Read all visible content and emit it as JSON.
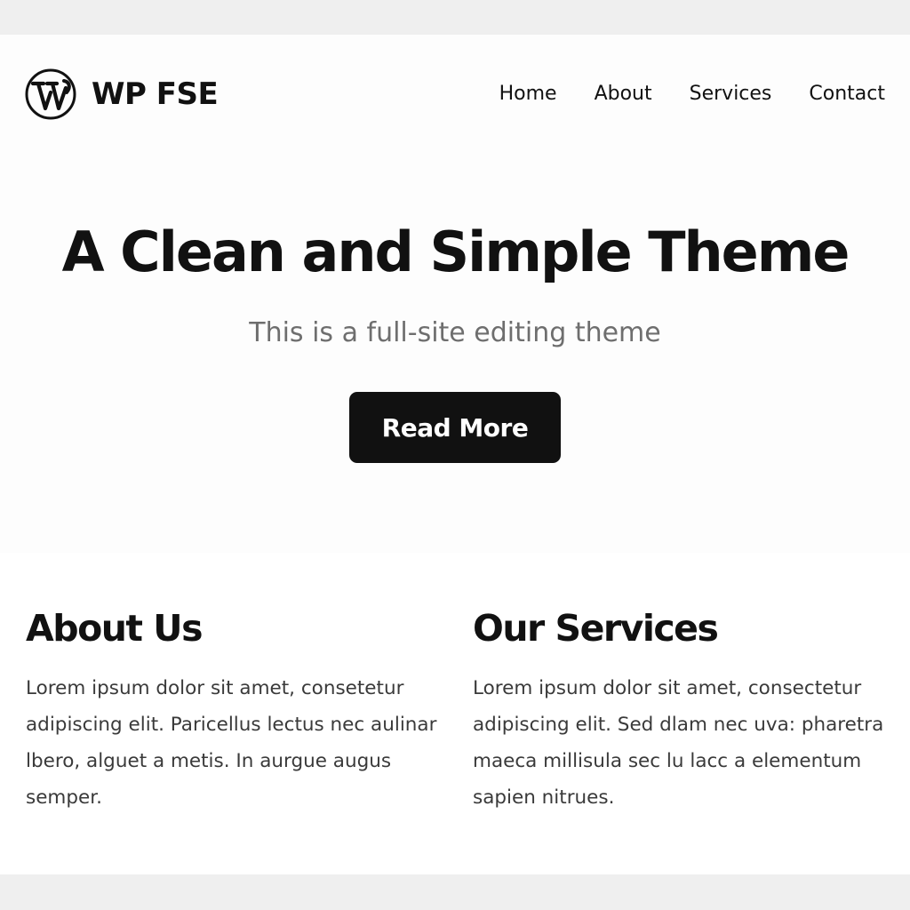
{
  "header": {
    "site_title": "WP FSE",
    "logo_icon": "wordpress-logo-icon",
    "nav": [
      "Home",
      "About",
      "Services",
      "Contact"
    ]
  },
  "hero": {
    "title": "A Clean and Simple Theme",
    "subtitle": "This is a full-site editing theme",
    "button_label": "Read More"
  },
  "sections": {
    "about": {
      "heading": "About Us",
      "body": "Lorem ipsum dolor sit amet, consetetur adipiscing elit. Paricellus lectus nec aulinar lbero, alguet a metis. In aurgue augus semper."
    },
    "services": {
      "heading": "Our Services",
      "body": "Lorem ipsum dolor sit amet, consectetur adipiscing elit. Sed dlam nec uva: pharetra maeca millisula sec lu lacc a elementum sapien nitrues."
    }
  },
  "colors": {
    "text": "#111111",
    "subtitle": "#6e6e6e",
    "body_text": "#3a3a3a",
    "button_bg": "#111111",
    "button_text": "#ffffff",
    "page_bg": "#ffffff",
    "outer_bg": "#efefef"
  }
}
